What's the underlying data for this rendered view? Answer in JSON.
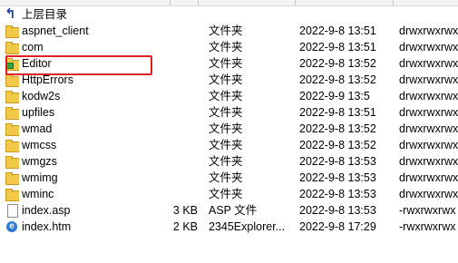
{
  "parent": {
    "label": "上层目录",
    "icon": "parent-dir-icon"
  },
  "rows": [
    {
      "name": "aspnet_client",
      "size": "",
      "type": "文件夹",
      "date": "2022-9-8 13:51",
      "perm": "drwxrwxrwx",
      "icon": "folder-icon"
    },
    {
      "name": "com",
      "size": "",
      "type": "文件夹",
      "date": "2022-9-8 13:51",
      "perm": "drwxrwxrwx",
      "icon": "folder-icon"
    },
    {
      "name": "Editor",
      "size": "",
      "type": "文件夹",
      "date": "2022-9-8 13:52",
      "perm": "drwxrwxrwx",
      "icon": "locked-folder-icon"
    },
    {
      "name": "HttpErrors",
      "size": "",
      "type": "文件夹",
      "date": "2022-9-8 13:52",
      "perm": "drwxrwxrwx",
      "icon": "folder-icon"
    },
    {
      "name": "kodw2s",
      "size": "",
      "type": "文件夹",
      "date": "2022-9-9 13:5",
      "perm": "drwxrwxrwx",
      "icon": "folder-icon"
    },
    {
      "name": "upfiles",
      "size": "",
      "type": "文件夹",
      "date": "2022-9-8 13:51",
      "perm": "drwxrwxrwx",
      "icon": "folder-icon"
    },
    {
      "name": "wmad",
      "size": "",
      "type": "文件夹",
      "date": "2022-9-8 13:52",
      "perm": "drwxrwxrwx",
      "icon": "folder-icon"
    },
    {
      "name": "wmcss",
      "size": "",
      "type": "文件夹",
      "date": "2022-9-8 13:52",
      "perm": "drwxrwxrwx",
      "icon": "folder-icon"
    },
    {
      "name": "wmgzs",
      "size": "",
      "type": "文件夹",
      "date": "2022-9-8 13:53",
      "perm": "drwxrwxrwx",
      "icon": "folder-icon"
    },
    {
      "name": "wmimg",
      "size": "",
      "type": "文件夹",
      "date": "2022-9-8 13:53",
      "perm": "drwxrwxrwx",
      "icon": "folder-icon"
    },
    {
      "name": "wminc",
      "size": "",
      "type": "文件夹",
      "date": "2022-9-8 13:53",
      "perm": "drwxrwxrwx",
      "icon": "folder-icon"
    },
    {
      "name": "index.asp",
      "size": "3 KB",
      "type": "ASP 文件",
      "date": "2022-9-8 13:53",
      "perm": "-rwxrwxrwx",
      "icon": "file-icon"
    },
    {
      "name": "index.htm",
      "size": "2 KB",
      "type": "2345Explorer...",
      "date": "2022-9-8 17:29",
      "perm": "-rwxrwxrwx",
      "icon": "ie-file-icon"
    }
  ],
  "highlight": {
    "color": "#e02020"
  }
}
